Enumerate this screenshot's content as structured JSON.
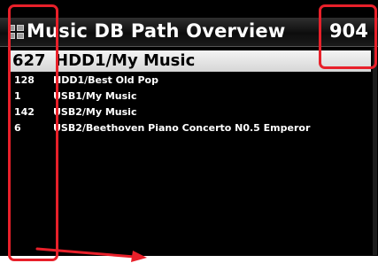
{
  "title_bar": {
    "icon": "grid-icon",
    "title": "Music DB Path Overview",
    "total": "904"
  },
  "selected": {
    "count": "627",
    "path": "HDD1/My Music"
  },
  "rows": [
    {
      "count": "128",
      "path": "HDD1/Best Old Pop"
    },
    {
      "count": "1",
      "path": "USB1/My Music"
    },
    {
      "count": "142",
      "path": "USB2/My Music"
    },
    {
      "count": "6",
      "path": "USB2/Beethoven Piano Concerto N0.5 Emperor"
    }
  ],
  "colors": {
    "annotation": "#e8202a",
    "background": "#000000",
    "selection": "#e6e6e6"
  }
}
